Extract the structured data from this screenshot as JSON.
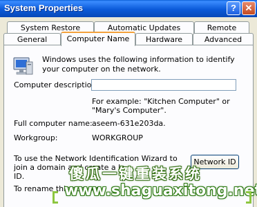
{
  "window": {
    "title": "System Properties",
    "help_label": "?",
    "close_label": "✕"
  },
  "tabs": {
    "row1": [
      "System Restore",
      "Automatic Updates",
      "Remote"
    ],
    "row2": [
      "General",
      "Computer Name",
      "Hardware",
      "Advanced"
    ],
    "active": "Computer Name"
  },
  "panel": {
    "intro": "Windows uses the following information to identify your computer on the network.",
    "description_label": "Computer description:",
    "description_value": "",
    "description_example": "For example: \"Kitchen Computer\" or \"Mary's Computer\".",
    "full_name_label": "Full computer name:",
    "full_name_value": "aseem-631e203da.",
    "workgroup_label": "Workgroup:",
    "workgroup_value": "WORKGROUP",
    "wizard_text": "To use the Network Identification Wizard to join a domain and create a lo",
    "wizard_text_tail": "ID.",
    "network_id_button": "Network ID",
    "rename_text": "To rename this compu"
  },
  "watermark": {
    "chinese": "傻瓜一键重装系统",
    "url": "www.shaguaxitong.net"
  },
  "colors": {
    "titlebar": "#0b5ad9",
    "active_tab_accent": "#f3a13a",
    "watermark_green": "#8dc63f"
  },
  "icons": {
    "computer": "computer-monitor-icon",
    "help": "help-icon",
    "close": "close-icon"
  }
}
